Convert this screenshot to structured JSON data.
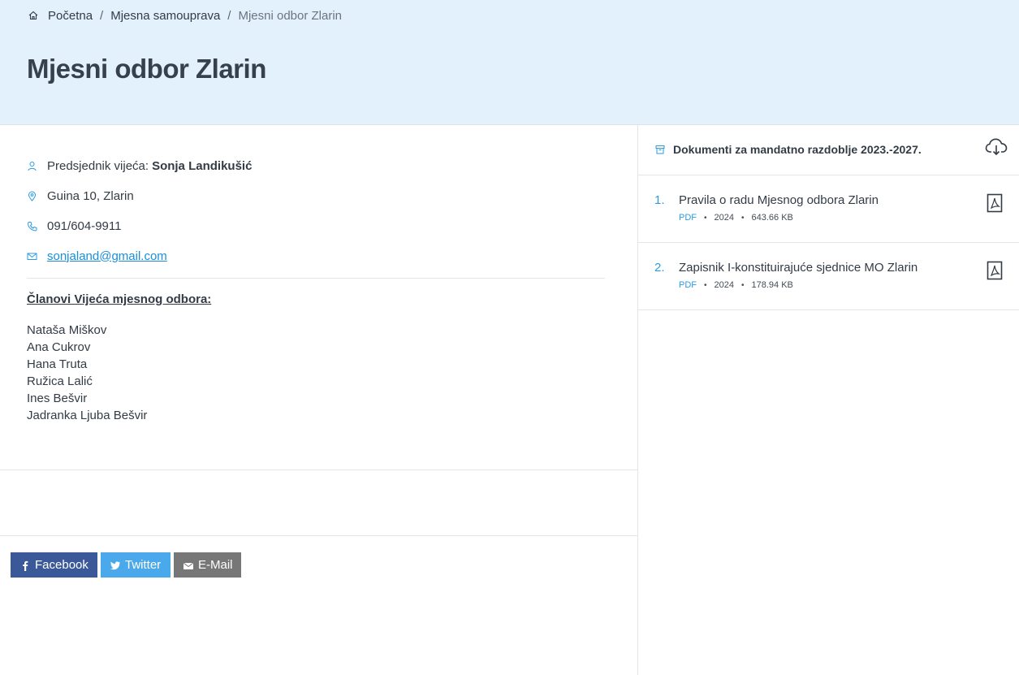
{
  "breadcrumb": {
    "items": [
      "Početna",
      "Mjesna samouprava"
    ],
    "separator": "/",
    "current": "Mjesni odbor Zlarin"
  },
  "page": {
    "title": "Mjesni odbor Zlarin"
  },
  "contact": {
    "president_label": "Predsjednik vijeća:",
    "president_name": "Sonja Landikušić",
    "address": "Guina 10, Zlarin",
    "phone": "091/604-9911",
    "email": "sonjaland@gmail.com"
  },
  "members": {
    "title": "Članovi Vijeća mjesnog odbora:",
    "list": [
      "Nataša Miškov",
      "Ana Cukrov",
      "Hana Truta",
      "Ružica Lalić",
      "Ines Bešvir",
      "Jadranka Ljuba Bešvir"
    ]
  },
  "share": {
    "facebook": "Facebook",
    "twitter": "Twitter",
    "email": "E-Mail"
  },
  "documents": {
    "title": "Dokumenti za mandatno razdoblje 2023.-2027.",
    "items": [
      {
        "num": "1.",
        "name": "Pravila o radu Mjesnog odbora Zlarin",
        "type": "PDF",
        "year": "2024",
        "size": "643.66 KB"
      },
      {
        "num": "2.",
        "name": "Zapisnik I-konstituirajuće sjednice MO Zlarin",
        "type": "PDF",
        "year": "2024",
        "size": "178.94 KB"
      }
    ]
  },
  "colors": {
    "hero_bg": "#e3f1fd",
    "accent": "#2b9be0",
    "facebook": "#3b5998",
    "twitter": "#4aa9ea",
    "email": "#777777"
  }
}
